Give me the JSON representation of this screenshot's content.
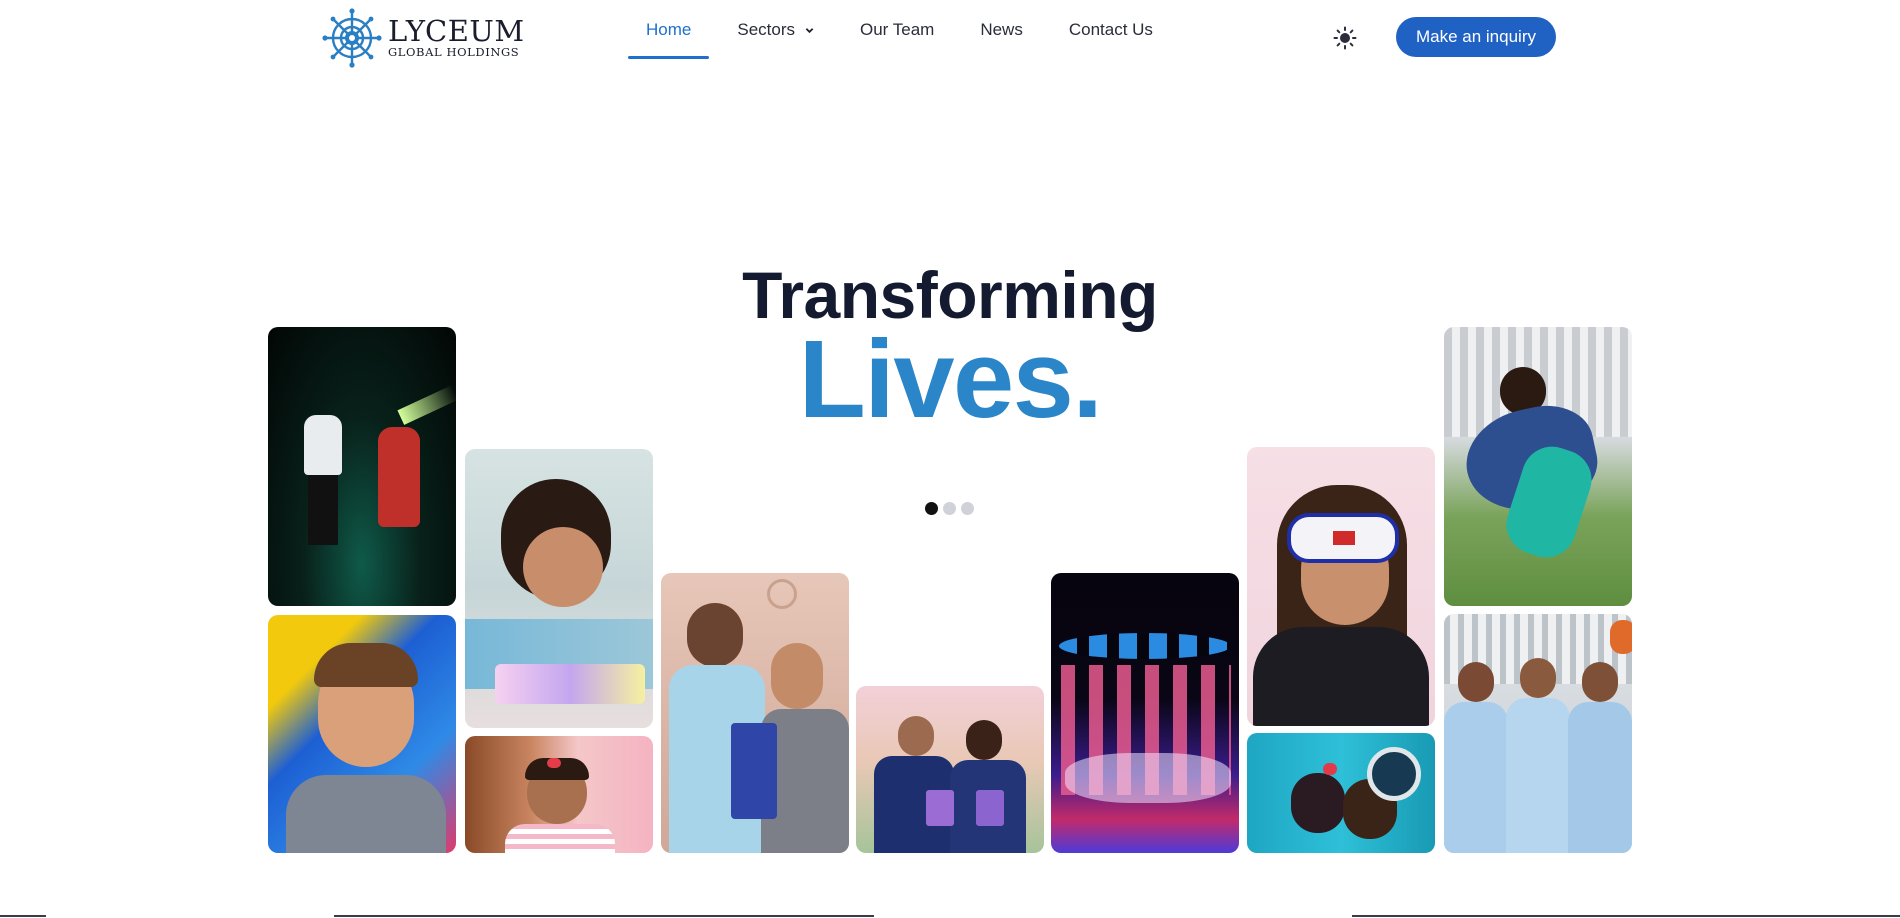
{
  "header": {
    "logo": {
      "title": "LYCEUM",
      "subtitle": "GLOBAL HOLDINGS"
    },
    "nav": [
      {
        "label": "Home",
        "active": true
      },
      {
        "label": "Sectors",
        "has_dropdown": true
      },
      {
        "label": "Our Team"
      },
      {
        "label": "News"
      },
      {
        "label": "Contact Us"
      }
    ],
    "theme_icon": "sun-icon",
    "cta_label": "Make an inquiry"
  },
  "hero": {
    "title": "Transforming",
    "subtitle": "Lives.",
    "carousel": {
      "slides": 3,
      "active_index": 0
    }
  },
  "colors": {
    "brand_blue": "#1f62c4",
    "accent_blue": "#2a86c8",
    "nav_active": "#1f6fcc",
    "heading_dark": "#141a30"
  }
}
